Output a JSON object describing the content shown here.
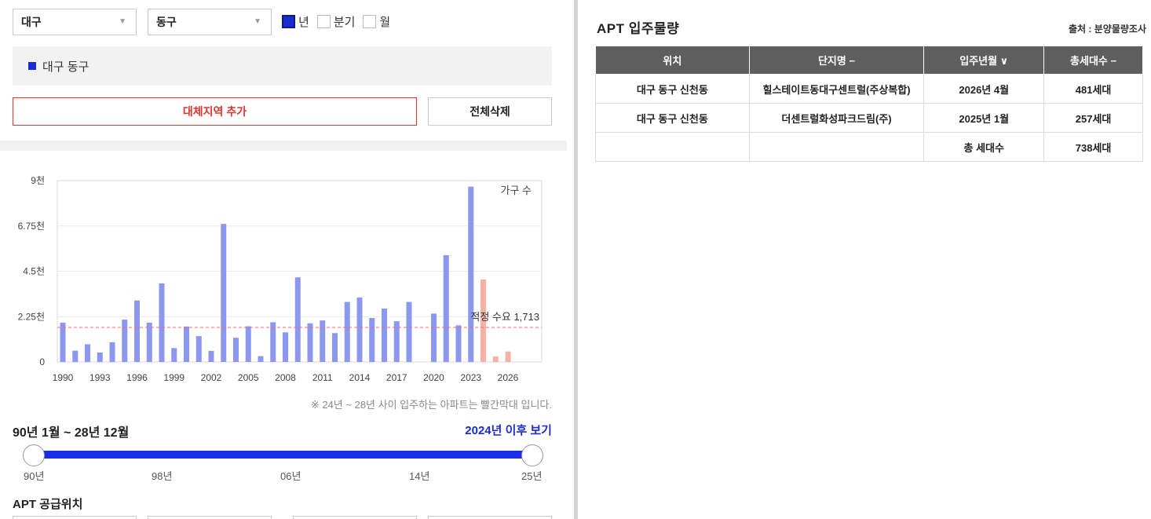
{
  "filters": {
    "province": "대구",
    "district": "동구",
    "period_options": [
      {
        "label": "년",
        "checked": true
      },
      {
        "label": "분기",
        "checked": false
      },
      {
        "label": "월",
        "checked": false
      }
    ]
  },
  "selected_region": "대구 동구",
  "buttons": {
    "add_region": "대체지역 추가",
    "delete_all": "전체삭제"
  },
  "chart_data": {
    "type": "bar",
    "legend": "가구 수",
    "y_ticks": [
      "9천",
      "6.75천",
      "4.5천",
      "2.25천",
      "0"
    ],
    "ylim": [
      0,
      9000
    ],
    "x_ticks": [
      "1990",
      "1993",
      "1996",
      "1999",
      "2002",
      "2005",
      "2008",
      "2011",
      "2014",
      "2017",
      "2020",
      "2023",
      "2026"
    ],
    "years": [
      1990,
      1991,
      1992,
      1993,
      1994,
      1995,
      1996,
      1997,
      1998,
      1999,
      2000,
      2001,
      2002,
      2003,
      2004,
      2005,
      2006,
      2007,
      2008,
      2009,
      2010,
      2011,
      2012,
      2013,
      2014,
      2015,
      2016,
      2017,
      2018,
      2019,
      2020,
      2021,
      2022,
      2023,
      2024,
      2025,
      2026
    ],
    "values": [
      1950,
      560,
      880,
      470,
      980,
      2100,
      3050,
      1950,
      3900,
      690,
      1760,
      1280,
      550,
      6850,
      1200,
      1770,
      290,
      1970,
      1470,
      4200,
      1920,
      2060,
      1430,
      2980,
      3200,
      2180,
      2650,
      2020,
      2980,
      0,
      2400,
      5300,
      1820,
      8700,
      4100,
      270,
      520
    ],
    "future_from_year": 2024,
    "colors": {
      "past": "#8c98ef",
      "future": "#f7b0a6",
      "threshold": "#f06a75"
    },
    "threshold": {
      "label": "적정 수요 1,713",
      "value": 1713
    }
  },
  "chart_note": "※ 24년 ~ 28년 사이 입주하는 아파트는 빨간막대 입니다.",
  "range": {
    "title": "90년 1월 ~ 28년 12월",
    "link": "2024년 이후 보기",
    "labels": [
      "90년",
      "98년",
      "06년",
      "14년",
      "25년"
    ]
  },
  "supply_location_title": "APT 공급위치",
  "apt": {
    "title": "APT 입주물량",
    "source": "출처 : 분양물량조사",
    "headers": [
      "위치",
      "단지명 −",
      "입주년월 ∨",
      "총세대수 −"
    ],
    "rows": [
      [
        "대구 동구 신천동",
        "힐스테이트동대구센트럴(주상복합)",
        "2026년 4월",
        "481세대"
      ],
      [
        "대구 동구 신천동",
        "더센트럴화성파크드림(주)",
        "2025년 1월",
        "257세대"
      ],
      [
        "",
        "",
        "총 세대수",
        "738세대"
      ]
    ]
  }
}
